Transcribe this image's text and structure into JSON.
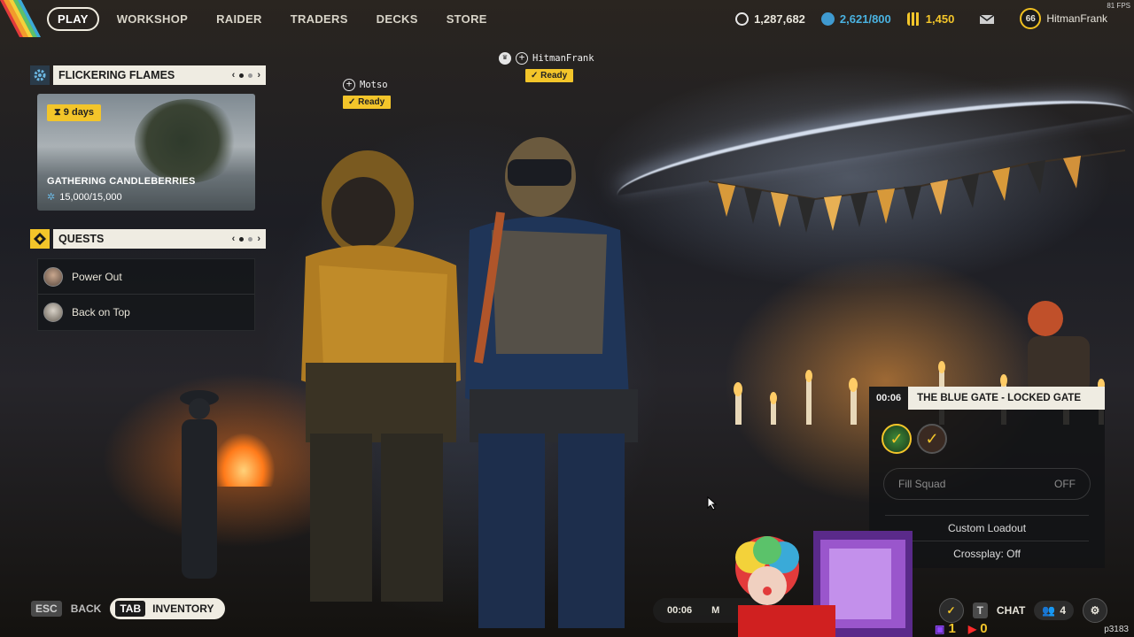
{
  "nav": {
    "items": [
      "PLAY",
      "WORKSHOP",
      "RAIDER",
      "TRADERS",
      "DECKS",
      "STORE"
    ]
  },
  "currencies": {
    "coins": "1,287,682",
    "tokens": "2,621/800",
    "credits": "1,450",
    "level": "66",
    "username": "HitmanFrank"
  },
  "fps": "81 FPS",
  "event": {
    "title": "FLICKERING FLAMES",
    "days": "9 days",
    "name": "GATHERING CANDLEBERRIES",
    "progress": "15,000/15,000"
  },
  "quests": {
    "title": "QUESTS",
    "items": [
      "Power Out",
      "Back on Top"
    ]
  },
  "players": [
    {
      "name": "Motso",
      "status": "Ready"
    },
    {
      "name": "HitmanFrank",
      "status": "Ready"
    }
  ],
  "squad": {
    "time": "00:06",
    "title": "THE BLUE GATE - LOCKED GATE",
    "fill_label": "Fill Squad",
    "fill_value": "OFF",
    "custom_loadout": "Custom Loadout",
    "crossplay": "Crossplay: Off"
  },
  "bottom": {
    "esc_key": "ESC",
    "back_label": "BACK",
    "tab_key": "TAB",
    "inventory_label": "INVENTORY",
    "timer": "00:06",
    "timer_suffix": "M",
    "chat_key": "T",
    "chat_label": "CHAT",
    "squad_count": "4",
    "twitch_count": "1",
    "youtube_count": "0",
    "user_id": "p3183"
  },
  "colors": {
    "accent_yellow": "#f3c52a",
    "panel_light": "#efece2",
    "panel_dark": "#14161a"
  }
}
